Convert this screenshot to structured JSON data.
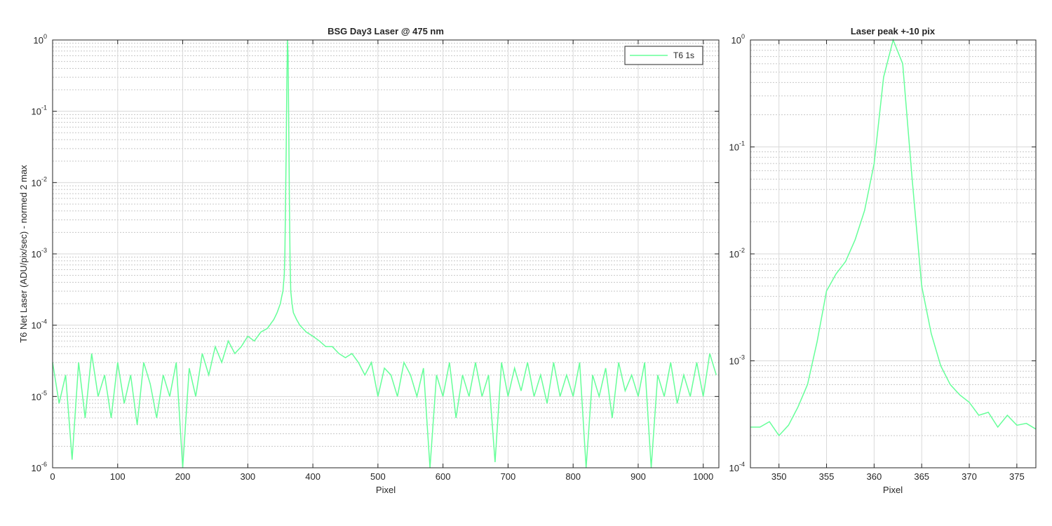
{
  "chart_data": [
    {
      "type": "line",
      "title": "BSG  Day3 Laser @ 475 nm",
      "xlabel": "Pixel",
      "ylabel": "T6 Net Laser (ADU/pix/sec) - normed 2 max",
      "xlim": [
        0,
        1024
      ],
      "ylim": [
        1e-06,
        1
      ],
      "yscale": "log",
      "xticks": [
        "0",
        "100",
        "200",
        "300",
        "400",
        "500",
        "600",
        "700",
        "800",
        "900",
        "1000"
      ],
      "yticks": [
        {
          "base": "10",
          "exp": "-6"
        },
        {
          "base": "10",
          "exp": "-5"
        },
        {
          "base": "10",
          "exp": "-4"
        },
        {
          "base": "10",
          "exp": "-3"
        },
        {
          "base": "10",
          "exp": "-2"
        },
        {
          "base": "10",
          "exp": "-1"
        },
        {
          "base": "10",
          "exp": "0"
        }
      ],
      "grid": true,
      "legend_position": "top-right",
      "series": [
        {
          "name": "T6 1s",
          "color": "#66ff99",
          "x": [
            0,
            10,
            20,
            30,
            40,
            50,
            60,
            70,
            80,
            90,
            100,
            110,
            120,
            130,
            140,
            150,
            160,
            170,
            180,
            190,
            200,
            210,
            220,
            230,
            240,
            250,
            260,
            270,
            280,
            290,
            300,
            310,
            320,
            330,
            340,
            345,
            350,
            352,
            354,
            356,
            357,
            358,
            359,
            360,
            361,
            362,
            363,
            364,
            365,
            366,
            368,
            370,
            375,
            380,
            390,
            400,
            410,
            420,
            430,
            440,
            450,
            460,
            470,
            480,
            490,
            500,
            510,
            520,
            530,
            540,
            550,
            560,
            570,
            580,
            590,
            600,
            610,
            620,
            630,
            640,
            650,
            660,
            670,
            680,
            690,
            700,
            710,
            720,
            730,
            740,
            750,
            760,
            770,
            780,
            790,
            800,
            810,
            820,
            830,
            840,
            850,
            860,
            870,
            880,
            890,
            900,
            910,
            920,
            930,
            940,
            950,
            960,
            970,
            980,
            990,
            1000,
            1010,
            1020
          ],
          "y": [
            3e-05,
            8e-06,
            2e-05,
            1.3e-06,
            3e-05,
            5e-06,
            4e-05,
            1e-05,
            2e-05,
            5e-06,
            3e-05,
            8e-06,
            2e-05,
            4e-06,
            3e-05,
            1.5e-05,
            5e-06,
            2e-05,
            1e-05,
            3e-05,
            1e-06,
            2.5e-05,
            1e-05,
            4e-05,
            2e-05,
            5e-05,
            3e-05,
            6e-05,
            4e-05,
            5e-05,
            7e-05,
            6e-05,
            8e-05,
            9e-05,
            0.00012,
            0.00015,
            0.0002,
            0.00025,
            0.0003,
            0.0005,
            0.001,
            0.005,
            0.03,
            0.25,
            1,
            0.6,
            0.05,
            0.005,
            0.0008,
            0.0003,
            0.0002,
            0.00015,
            0.00012,
            0.0001,
            8e-05,
            7e-05,
            6e-05,
            5e-05,
            5e-05,
            4e-05,
            3.5e-05,
            4e-05,
            3e-05,
            2e-05,
            3e-05,
            1e-05,
            2.5e-05,
            2e-05,
            1e-05,
            3e-05,
            2e-05,
            1e-05,
            2.5e-05,
            1e-06,
            2e-05,
            1e-05,
            3e-05,
            5e-06,
            2e-05,
            1e-05,
            3e-05,
            1e-05,
            2e-05,
            1.2e-06,
            3e-05,
            1e-05,
            2.5e-05,
            1.2e-05,
            3e-05,
            1e-05,
            2e-05,
            8e-06,
            3e-05,
            1e-05,
            2e-05,
            1e-05,
            3e-05,
            1e-06,
            2e-05,
            1e-05,
            2.5e-05,
            5e-06,
            3e-05,
            1.2e-05,
            2e-05,
            1e-05,
            3e-05,
            1e-06,
            2e-05,
            1e-05,
            3e-05,
            8e-06,
            2e-05,
            1e-05,
            3e-05,
            1e-05,
            4e-05,
            2e-05
          ]
        }
      ]
    },
    {
      "type": "line",
      "title": "Laser peak +-10 pix",
      "xlabel": "Pixel",
      "xlim": [
        347,
        377
      ],
      "ylim": [
        0.0001,
        1
      ],
      "yscale": "log",
      "xticks": [
        "350",
        "355",
        "360",
        "365",
        "370",
        "375"
      ],
      "yticks": [
        {
          "base": "10",
          "exp": "-4"
        },
        {
          "base": "10",
          "exp": "-3"
        },
        {
          "base": "10",
          "exp": "-2"
        },
        {
          "base": "10",
          "exp": "-1"
        },
        {
          "base": "10",
          "exp": "0"
        }
      ],
      "grid": true,
      "series": [
        {
          "color": "#66ff99",
          "x": [
            347,
            348,
            349,
            350,
            351,
            352,
            353,
            354,
            355,
            356,
            357,
            358,
            359,
            360,
            361,
            362,
            363,
            364,
            365,
            366,
            367,
            368,
            369,
            370,
            371,
            372,
            373,
            374,
            375,
            376,
            377
          ],
          "y": [
            0.00024,
            0.00024,
            0.00027,
            0.0002,
            0.00025,
            0.00037,
            0.0006,
            0.0015,
            0.0045,
            0.0065,
            0.0085,
            0.0135,
            0.0255,
            0.07,
            0.45,
            1,
            0.6,
            0.05,
            0.005,
            0.0018,
            0.0009,
            0.0006,
            0.00048,
            0.00041,
            0.00031,
            0.00033,
            0.00024,
            0.00031,
            0.00025,
            0.00026,
            0.00023
          ]
        }
      ]
    }
  ]
}
